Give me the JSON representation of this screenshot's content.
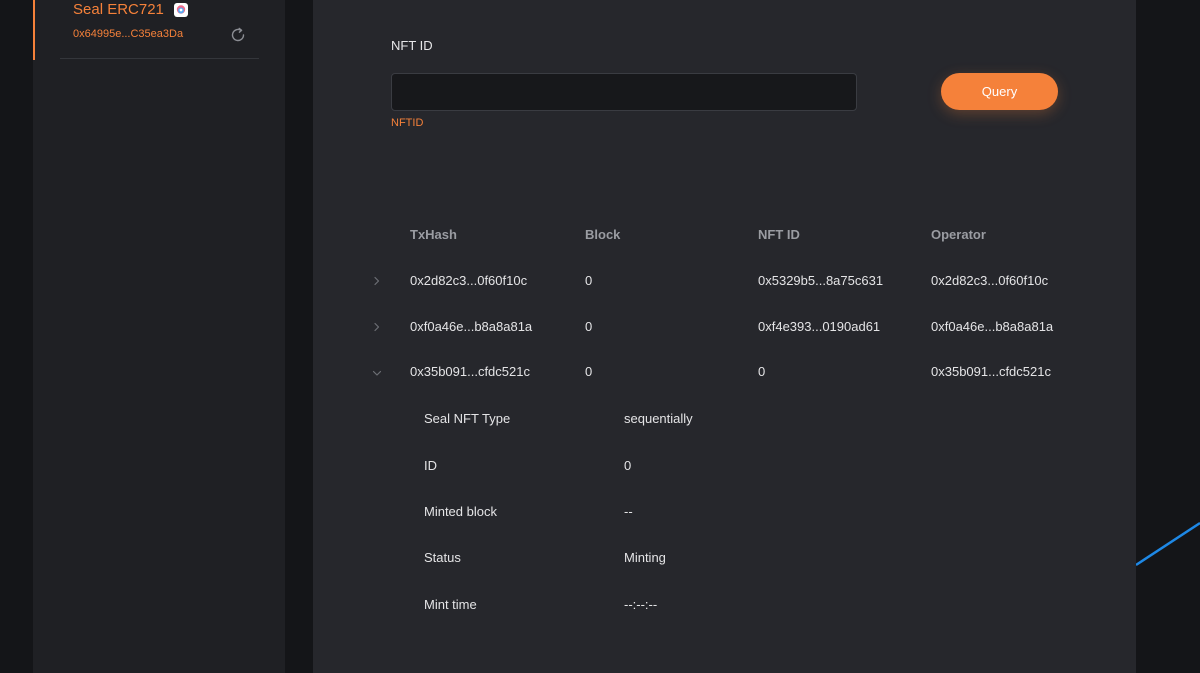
{
  "sidebar": {
    "contract": {
      "name": "Seal ERC721",
      "address": "0x64995e...C35ea3Da",
      "logo_icon": "seal-logo-icon",
      "refresh_icon": "refresh-icon"
    }
  },
  "query": {
    "label": "NFT ID",
    "input_value": "",
    "placeholder": "",
    "error_text": "NFTID",
    "button_label": "Query"
  },
  "table": {
    "headers": [
      "TxHash",
      "Block",
      "NFT ID",
      "Operator"
    ],
    "rows": [
      {
        "txhash": "0x2d82c3...0f60f10c",
        "block": "0",
        "nft_id": "0x5329b5...8a75c631",
        "operator": "0x2d82c3...0f60f10c",
        "expanded": false
      },
      {
        "txhash": "0xf0a46e...b8a8a81a",
        "block": "0",
        "nft_id": "0xf4e393...0190ad61",
        "operator": "0xf0a46e...b8a8a81a",
        "expanded": false
      },
      {
        "txhash": "0x35b091...cfdc521c",
        "block": "0",
        "nft_id": "0",
        "operator": "0x35b091...cfdc521c",
        "expanded": true
      }
    ],
    "details": [
      {
        "label": "Seal NFT Type",
        "value": "sequentially"
      },
      {
        "label": "ID",
        "value": "0"
      },
      {
        "label": "Minted block",
        "value": "--"
      },
      {
        "label": "Status",
        "value": "Minting"
      },
      {
        "label": "Mint time",
        "value": "--:--:--"
      }
    ]
  },
  "colors": {
    "accent": "#f5813a",
    "panel_bg": "#26272c",
    "sidebar_bg": "#1f2024",
    "page_bg": "#141518",
    "decor_line": "#1e88e5"
  }
}
